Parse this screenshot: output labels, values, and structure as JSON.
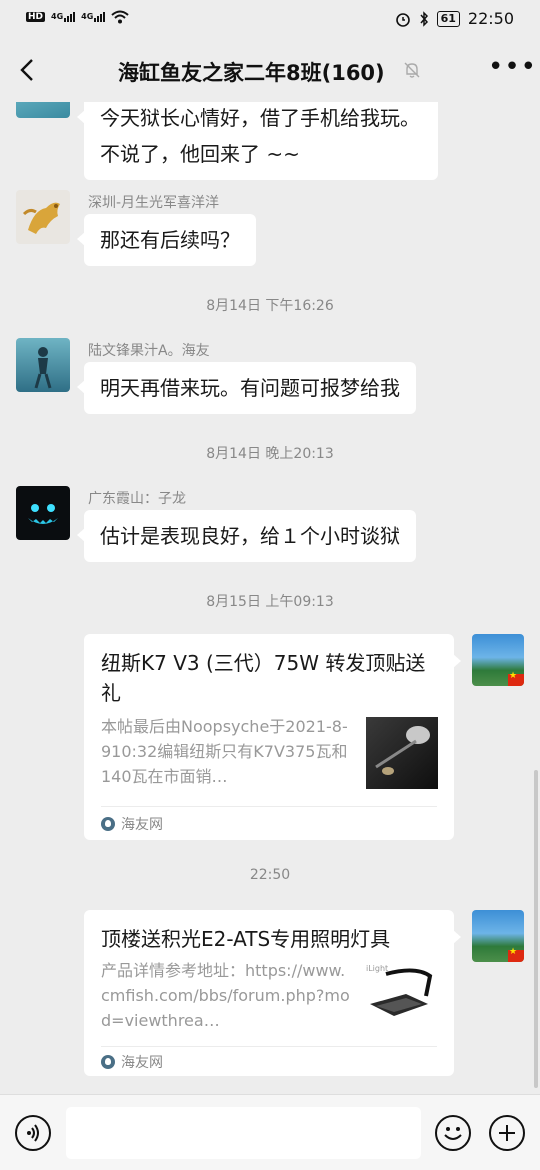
{
  "status_bar": {
    "network_left": "HD",
    "signal1": "4G",
    "signal2": "4G",
    "battery": "61",
    "time": "22:50"
  },
  "nav": {
    "back_icon": "chevron-left-icon",
    "title": "海缸鱼友之家二年8班(160)",
    "mute_icon": "bell-muted-icon",
    "more_icon": "more-dots-icon"
  },
  "messages": [
    {
      "text": "今天狱长心情好，借了手机给我玩。不说了，他回来了 ~~"
    },
    {
      "sender": "深圳-月生光军喜洋洋",
      "text": "那还有后续吗？"
    },
    {
      "timestamp": "8月14日 下午16:26"
    },
    {
      "sender": "陆文锋果汁A。海友",
      "text": "明天再借来玩。有问题可报梦给我"
    },
    {
      "timestamp": "8月14日 晚上20:13"
    },
    {
      "sender": "广东霞山：子龙",
      "text": "估计是表现良好，给１个小时谈狱"
    },
    {
      "timestamp": "8月15日 上午09:13"
    },
    {
      "card_title": "纽斯K7 V3 (三代）75W 转发顶贴送礼",
      "card_desc": "本帖最后由Noopsyche于2021-8-910:32编辑纽斯只有K7V375瓦和140瓦在市面销…",
      "card_source": "海友网"
    },
    {
      "timestamp": "22:50"
    },
    {
      "card_title": "顶楼送积光E2-ATS专用照明灯具",
      "card_desc": "产品详情参考地址：https://www.cmfish.com/bbs/forum.php?mod=viewthrea…",
      "card_source": "海友网",
      "thumb_text": "iLight"
    }
  ],
  "input_bar": {
    "voice_icon": "voice-icon",
    "text_value": "",
    "emoji_icon": "emoji-icon",
    "plus_icon": "plus-icon"
  },
  "colors": {
    "background": "#ededed",
    "bubble": "#ffffff",
    "meta_text": "#888888"
  }
}
